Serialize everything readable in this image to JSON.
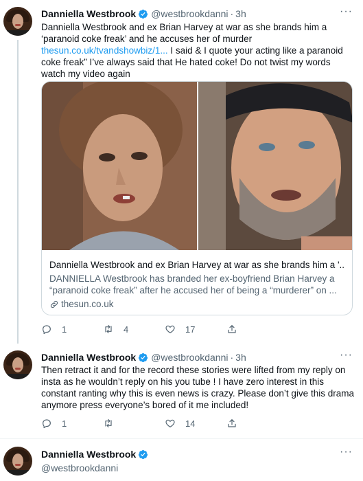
{
  "tweets": [
    {
      "name": "Danniella Westbrook",
      "handle": "@westbrookdanni",
      "dot": "·",
      "time": "3h",
      "text_before_link": "Danniella Westbrook and ex Brian Harvey at war as she brands him a ‘paranoid coke freak’ and he accuses her of murder ",
      "link": "thesun.co.uk/tvandshowbiz/1...",
      "text_after_link": " I said & I quote your acting like a paranoid coke freak” I’ve always said that He hated coke! Do not twist my words watch my video again",
      "card": {
        "title": "Danniella Westbrook and ex Brian Harvey at war as she brands him a '...",
        "description": "DANNIELLA Westbrook has branded her ex-boyfriend Brian Harvey a “paranoid coke freak” after he accused her of being a “murderer” on ...",
        "domain": "thesun.co.uk"
      },
      "replies": "1",
      "retweets": "4",
      "likes": "17"
    },
    {
      "name": "Danniella Westbrook",
      "handle": "@westbrookdanni",
      "dot": "·",
      "time": "3h",
      "text": "Then retract it and for the record these stories were lifted from my reply on insta as he wouldn’t reply on his you tube ! I have zero interest in this constant ranting why this is even news is crazy. Please don’t give this drama anymore press everyone’s bored of it me included!",
      "replies": "1",
      "retweets": "",
      "likes": "14"
    },
    {
      "name": "Danniella Westbrook",
      "handle": "@westbrookdanni"
    }
  ],
  "colors": {
    "link": "#1d9bf0",
    "verified": "#1d9bf0",
    "secondary_text": "#536471"
  },
  "icons": [
    "more-icon",
    "verified-badge-icon",
    "reply-icon",
    "retweet-icon",
    "like-icon",
    "share-icon",
    "link-icon"
  ]
}
